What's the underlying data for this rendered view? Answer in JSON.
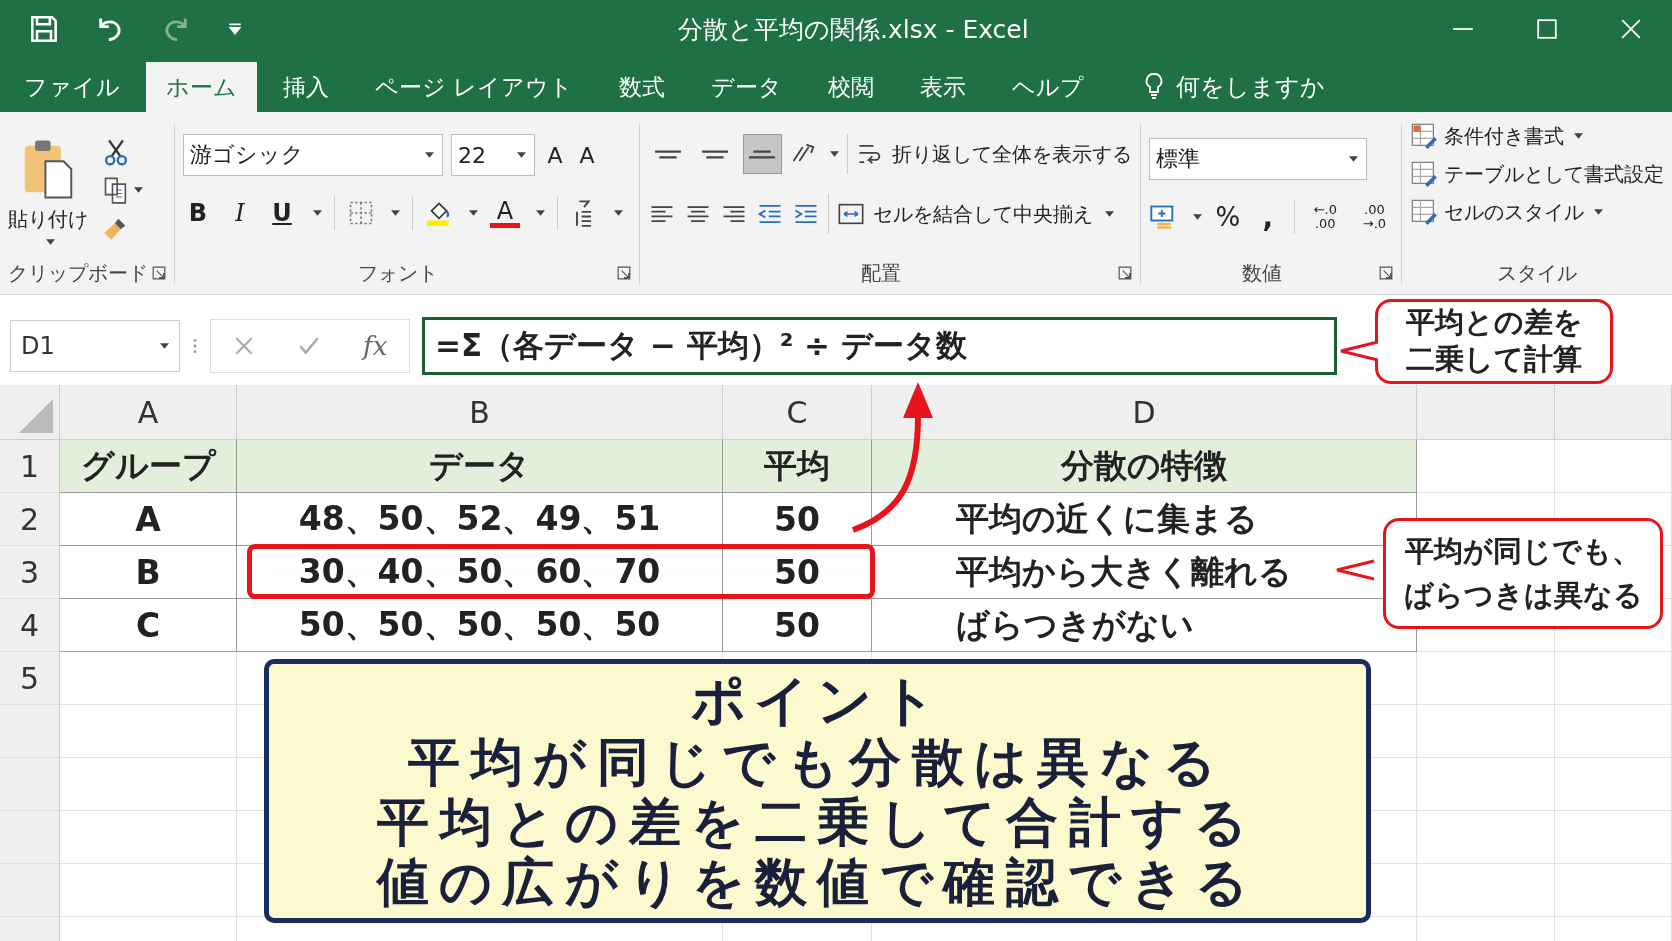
{
  "window": {
    "title": "分散と平均の関係.xlsx  -  Excel"
  },
  "quick_access": [
    {
      "kind": "save",
      "disabled": false
    },
    {
      "kind": "undo",
      "disabled": false
    },
    {
      "kind": "redo",
      "disabled": true
    },
    {
      "kind": "customize",
      "disabled": false
    }
  ],
  "tabs": [
    {
      "label": "ファイル",
      "selected": false
    },
    {
      "label": "ホーム",
      "selected": true
    },
    {
      "label": "挿入",
      "selected": false
    },
    {
      "label": "ページ レイアウト",
      "selected": false
    },
    {
      "label": "数式",
      "selected": false
    },
    {
      "label": "データ",
      "selected": false
    },
    {
      "label": "校閲",
      "selected": false
    },
    {
      "label": "表示",
      "selected": false
    },
    {
      "label": "ヘルプ",
      "selected": false
    }
  ],
  "tell_me": "何をしますか",
  "ribbon": {
    "clipboard": {
      "paste": "貼り付け",
      "label": "クリップボード"
    },
    "font": {
      "name": "游ゴシック",
      "size": "22",
      "grow": "A",
      "shrink": "A",
      "bold": "B",
      "italic": "I",
      "underline": "U",
      "font_color_letter": "A",
      "label": "フォント"
    },
    "alignment": {
      "vertical": [
        {
          "kind": "top",
          "selected": false
        },
        {
          "kind": "middle",
          "selected": false
        },
        {
          "kind": "bottom",
          "selected": true
        }
      ],
      "wrap": "折り返して全体を表示する",
      "merge": "セルを結合して中央揃え",
      "label": "配置"
    },
    "number": {
      "format": "標準",
      "percent": "%",
      "comma": ",",
      "increase_decimal": [
        "←.0",
        ".00"
      ],
      "decrease_decimal": [
        ".00",
        "→.0"
      ],
      "label": "数値"
    },
    "styles": {
      "items": [
        {
          "label": "条件付き書式",
          "caret": true
        },
        {
          "label": "テーブルとして書式設定",
          "caret": false
        },
        {
          "label": "セルのスタイル",
          "caret": true
        }
      ],
      "label": "スタイル"
    }
  },
  "formula_bar": {
    "name_box": "D1",
    "fx": "fx",
    "formula": "=Σ（各データ − 平均）² ÷ データ数"
  },
  "sheet": {
    "columns": [
      "A",
      "B",
      "C",
      "D"
    ],
    "rows": [
      {
        "number": "1",
        "kind": "header",
        "highlighted": false,
        "cells": [
          "グループ",
          "データ",
          "平均",
          "分散の特徴"
        ]
      },
      {
        "number": "2",
        "kind": "data",
        "highlighted": false,
        "cells": [
          "A",
          "48、50、52、49、51",
          "50",
          "平均の近くに集まる"
        ]
      },
      {
        "number": "3",
        "kind": "data",
        "highlighted": true,
        "cells": [
          "B",
          "30、40、50、60、70",
          "50",
          "平均から大きく離れる"
        ]
      },
      {
        "number": "4",
        "kind": "data",
        "highlighted": false,
        "cells": [
          "C",
          "50、50、50、50、50",
          "50",
          "ばらつきがない"
        ]
      },
      {
        "number": "5",
        "kind": "empty",
        "highlighted": false,
        "cells": []
      }
    ]
  },
  "callouts": [
    {
      "lines": [
        "平均との差を",
        "二乗して計算"
      ]
    },
    {
      "lines": [
        "平均が同じでも、",
        "ばらつきは異なる"
      ]
    }
  ],
  "note": {
    "title": "ポイント",
    "lines": [
      "平均が同じでも分散は異なる",
      "平均との差を二乗して合計する",
      "値の広がりを数値で確認できる"
    ]
  }
}
